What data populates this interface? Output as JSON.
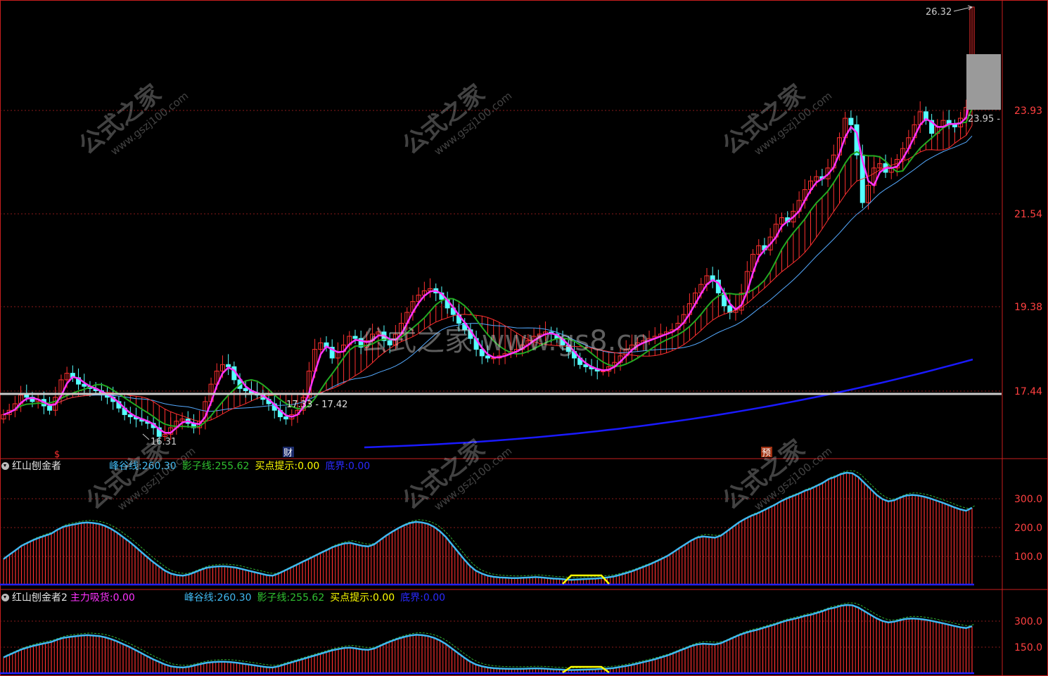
{
  "colors": {
    "background": "#000000",
    "axis": "#c81e1e",
    "grid": "#8a1a1a",
    "axis_text": "#ff4040",
    "up_candle": "#ff3030",
    "down_candle": "#55ffff",
    "ma_fast": "#ff33ff",
    "ma_green": "#22aa22",
    "ma_blue": "#55aaff",
    "ma_long": "#1a1aff",
    "support_line": "#cccccc",
    "osc_line": "#40b8f0",
    "osc_shadow": "#30b030",
    "osc_bar": "#ff3030",
    "buy_hint": "#ffff00",
    "bottom": "#2020ff"
  },
  "main_panel": {
    "price_labels": [
      "23.93",
      "21.54",
      "19.38",
      "17.44"
    ],
    "annotations": {
      "high": "26.32",
      "last": "23.95 -",
      "low": "16.31",
      "range": "17.33 - 17.42"
    },
    "markers": {
      "dividend": "$",
      "finance": "财",
      "forecast": "预"
    }
  },
  "watermarks": {
    "cn": "公式之家",
    "url": "www.gszj100.com",
    "center": "公式之家 www.gs8.cn"
  },
  "indicator1": {
    "title": "红山刨金者",
    "items": [
      {
        "label": "峰谷线:",
        "value": "260.30",
        "color": "#40b8f0"
      },
      {
        "label": "影子线:",
        "value": "255.62",
        "color": "#30c030"
      },
      {
        "label": "买点提示:",
        "value": "0.00",
        "color": "#ffff00"
      },
      {
        "label": "底界:",
        "value": "0.00",
        "color": "#2a2aff"
      }
    ],
    "axis_labels": [
      "300.0",
      "200.0",
      "100.0"
    ]
  },
  "indicator2": {
    "title": "红山刨金者2",
    "items": [
      {
        "label": "主力吸货:",
        "value": "0.00",
        "color": "#ff33ff"
      },
      {
        "label": "峰谷线:",
        "value": "260.30",
        "color": "#40b8f0"
      },
      {
        "label": "影子线:",
        "value": "255.62",
        "color": "#30c030"
      },
      {
        "label": "买点提示:",
        "value": "0.00",
        "color": "#ffff00"
      },
      {
        "label": "底界:",
        "value": "0.00",
        "color": "#2a2aff"
      }
    ],
    "axis_labels": [
      "300.0",
      "150.0"
    ]
  },
  "chart_data": {
    "type": "candlestick",
    "price_axis_ticks": [
      23.93,
      21.54,
      19.38,
      17.44
    ],
    "support_level": 17.42,
    "closes": [
      16.9,
      17.0,
      17.15,
      17.35,
      17.3,
      17.2,
      17.25,
      17.1,
      17.0,
      17.3,
      17.7,
      17.85,
      17.75,
      17.6,
      17.55,
      17.5,
      17.45,
      17.35,
      17.3,
      17.2,
      17.05,
      16.9,
      16.85,
      16.8,
      16.75,
      16.7,
      16.6,
      16.4,
      16.45,
      16.6,
      16.75,
      16.8,
      16.7,
      16.6,
      16.75,
      17.2,
      17.6,
      17.9,
      18.05,
      18.0,
      17.7,
      17.5,
      17.45,
      17.4,
      17.35,
      17.25,
      17.15,
      17.0,
      16.85,
      16.8,
      16.9,
      17.0,
      17.3,
      17.9,
      18.4,
      18.55,
      18.45,
      18.2,
      18.35,
      18.5,
      18.7,
      18.65,
      18.45,
      18.6,
      18.75,
      18.8,
      18.6,
      18.5,
      18.75,
      19.0,
      19.25,
      19.5,
      19.65,
      19.75,
      19.8,
      19.7,
      19.55,
      19.35,
      19.2,
      19.0,
      18.85,
      18.65,
      18.4,
      18.25,
      18.2,
      18.2,
      18.25,
      18.3,
      18.35,
      18.4,
      18.5,
      18.6,
      18.7,
      18.75,
      18.8,
      18.75,
      18.65,
      18.5,
      18.35,
      18.2,
      18.05,
      18.0,
      17.95,
      17.9,
      17.9,
      18.0,
      18.1,
      18.25,
      18.4,
      18.5,
      18.55,
      18.6,
      18.65,
      18.7,
      18.75,
      18.8,
      18.85,
      19.0,
      19.2,
      19.45,
      19.7,
      19.9,
      20.1,
      20.0,
      19.7,
      19.4,
      19.25,
      19.3,
      19.7,
      20.2,
      20.6,
      20.8,
      20.7,
      21.0,
      21.3,
      21.45,
      21.35,
      21.6,
      21.85,
      22.1,
      22.3,
      22.4,
      22.35,
      22.6,
      22.9,
      23.3,
      23.75,
      23.6,
      22.9,
      21.8,
      22.2,
      22.6,
      22.7,
      22.5,
      22.6,
      22.8,
      23.05,
      23.3,
      23.6,
      23.9,
      23.7,
      23.4,
      23.55,
      23.7,
      23.6,
      23.55,
      23.75,
      24.0,
      26.32
    ],
    "osc_peak_valley": [
      85,
      100,
      115,
      130,
      140,
      150,
      158,
      165,
      172,
      185,
      195,
      200,
      204,
      208,
      210,
      208,
      205,
      198,
      188,
      175,
      160,
      145,
      128,
      110,
      92,
      75,
      60,
      45,
      35,
      30,
      28,
      32,
      40,
      48,
      55,
      58,
      60,
      60,
      58,
      55,
      50,
      45,
      40,
      35,
      30,
      28,
      35,
      45,
      55,
      65,
      75,
      85,
      95,
      105,
      115,
      125,
      132,
      138,
      140,
      135,
      130,
      128,
      135,
      150,
      165,
      178,
      190,
      200,
      208,
      212,
      210,
      205,
      195,
      180,
      160,
      135,
      110,
      85,
      62,
      45,
      35,
      28,
      24,
      22,
      21,
      20,
      20,
      21,
      22,
      23,
      22,
      20,
      18,
      17,
      15,
      14,
      15,
      16,
      17,
      18,
      20,
      22,
      25,
      30,
      36,
      42,
      50,
      58,
      66,
      75,
      85,
      95,
      108,
      122,
      135,
      148,
      158,
      162,
      160,
      158,
      165,
      180,
      195,
      210,
      222,
      232,
      240,
      250,
      260,
      270,
      282,
      292,
      300,
      308,
      318,
      325,
      335,
      345,
      358,
      365,
      375,
      380,
      378,
      365,
      345,
      325,
      305,
      290,
      282,
      286,
      295,
      302,
      304,
      302,
      298,
      292,
      285,
      278,
      270,
      262,
      255,
      250,
      260
    ]
  }
}
